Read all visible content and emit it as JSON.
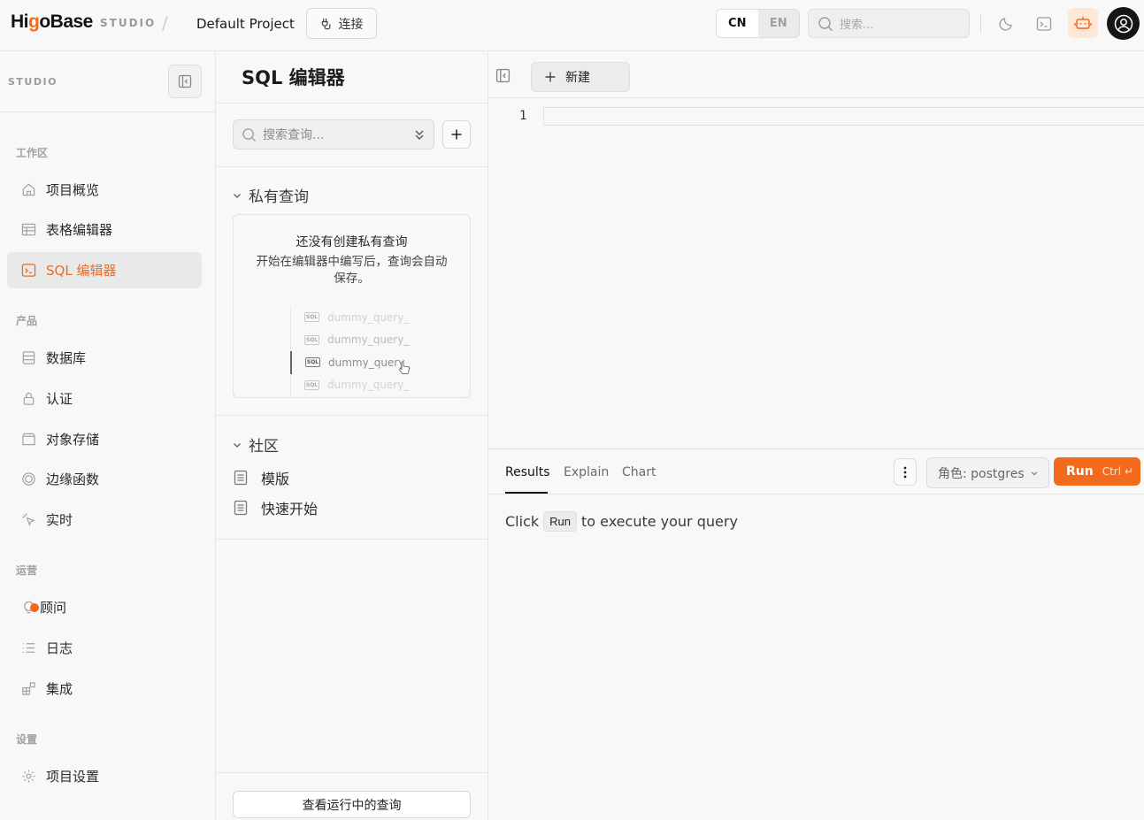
{
  "brand": {
    "logo_prefix": "Hi",
    "logo_accent": "g",
    "logo_suffix": "oBase",
    "studio_tag": "STUDIO",
    "separator": "/"
  },
  "header": {
    "project_name": "Default Project",
    "connect_label": "连接",
    "lang": {
      "cn": "CN",
      "en": "EN",
      "active": "CN"
    },
    "search_placeholder": "搜索...",
    "icons": [
      "moon-icon",
      "terminal-icon",
      "bot-icon",
      "user-avatar-icon"
    ]
  },
  "sidebar": {
    "title": "STUDIO",
    "sections": {
      "workspace": "工作区",
      "product": "产品",
      "operations": "运营",
      "settings": "设置"
    },
    "items": {
      "overview": "项目概览",
      "table_editor": "表格编辑器",
      "sql_editor": "SQL 编辑器",
      "database": "数据库",
      "auth": "认证",
      "storage": "对象存储",
      "edge_functions": "边缘函数",
      "realtime": "实时",
      "advisor": "顾问",
      "logs": "日志",
      "integrations": "集成",
      "project_settings": "项目设置"
    },
    "active": "sql_editor"
  },
  "queries_panel": {
    "title": "SQL 编辑器",
    "search_placeholder": "搜索查询...",
    "private_group": "私有查询",
    "empty_title": "还没有创建私有查询",
    "empty_desc": "开始在编辑器中编写后，查询会自动保存。",
    "dummy_queries": [
      "dummy_query_",
      "dummy_query_",
      "dummy_query_",
      "dummy_query_"
    ],
    "sql_badge": "SQL",
    "community_group": "社区",
    "community_items": [
      "模版",
      "快速开始"
    ],
    "running_button": "查看运行中的查询"
  },
  "editor": {
    "new_button": "新建",
    "line_numbers": [
      "1"
    ],
    "tabs": [
      "Results",
      "Explain",
      "Chart"
    ],
    "active_tab": "Results",
    "role_label": "角色: postgres",
    "run_label": "Run",
    "run_shortcut": "Ctrl ↵",
    "hint_before": "Click",
    "hint_code": "Run",
    "hint_after": "to execute your query"
  },
  "colors": {
    "accent": "#f26b1d",
    "active_bg": "#e9e9e9",
    "avatar_bg": "#161616"
  }
}
